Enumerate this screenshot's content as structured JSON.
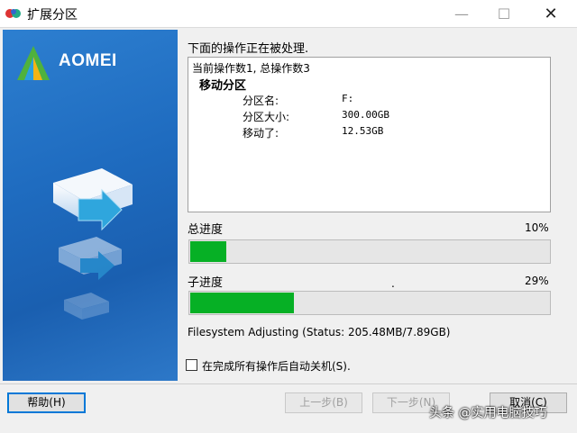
{
  "window": {
    "title": "扩展分区",
    "minimize_glyph": "—",
    "maximize_glyph": "☐",
    "close_glyph": "✕"
  },
  "banner": {
    "brand": "AOMEI"
  },
  "main": {
    "label": "下面的操作正在被处理.",
    "log": {
      "header": "当前操作数1, 总操作数3",
      "title": "移动分区",
      "rows": [
        {
          "label": "分区名:",
          "value": "F:"
        },
        {
          "label": "分区大小:",
          "value": "300.00GB"
        },
        {
          "label": "移动了:",
          "value": "12.53GB"
        }
      ]
    }
  },
  "overall_progress": {
    "label": "总进度",
    "percent_text": "10%",
    "value": 0.1
  },
  "sub_progress": {
    "label": "子进度",
    "dot": ".",
    "percent_text": "29%",
    "value": 0.29
  },
  "status": "Filesystem Adjusting (Status: 205.48MB/7.89GB)",
  "shutdown_option": {
    "label": "在完成所有操作后自动关机(S).",
    "checked": false
  },
  "buttons": {
    "help": "帮助(H)",
    "prev": "上一步(B)",
    "next": "下一步(N)",
    "cancel": "取消(C)"
  },
  "watermark": "头条 @实用电脑技巧",
  "colors": {
    "progress": "#06b025",
    "banner": "#1f6cc0"
  }
}
